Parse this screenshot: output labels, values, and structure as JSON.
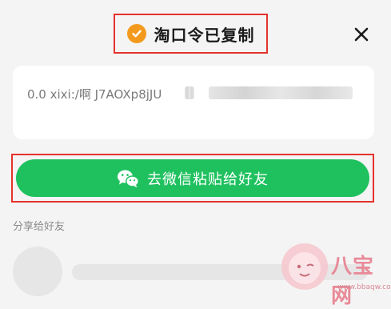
{
  "dialog": {
    "title": "淘口令已复制",
    "icons": {
      "title_badge": "check-circle-icon",
      "close": "close-icon"
    },
    "colors": {
      "badge": "#f39a1e",
      "highlight_border": "#e5322d"
    }
  },
  "code_card": {
    "text": "0.0 xixi:/啊 J7AOXp8jJU"
  },
  "wechat_button": {
    "label": "去微信粘贴给好友",
    "icon": "wechat-icon",
    "color": "#1fc15f"
  },
  "share_section": {
    "title": "分享给好友"
  },
  "watermark": {
    "text": "八宝网",
    "url": "www.bbaqw.com"
  }
}
